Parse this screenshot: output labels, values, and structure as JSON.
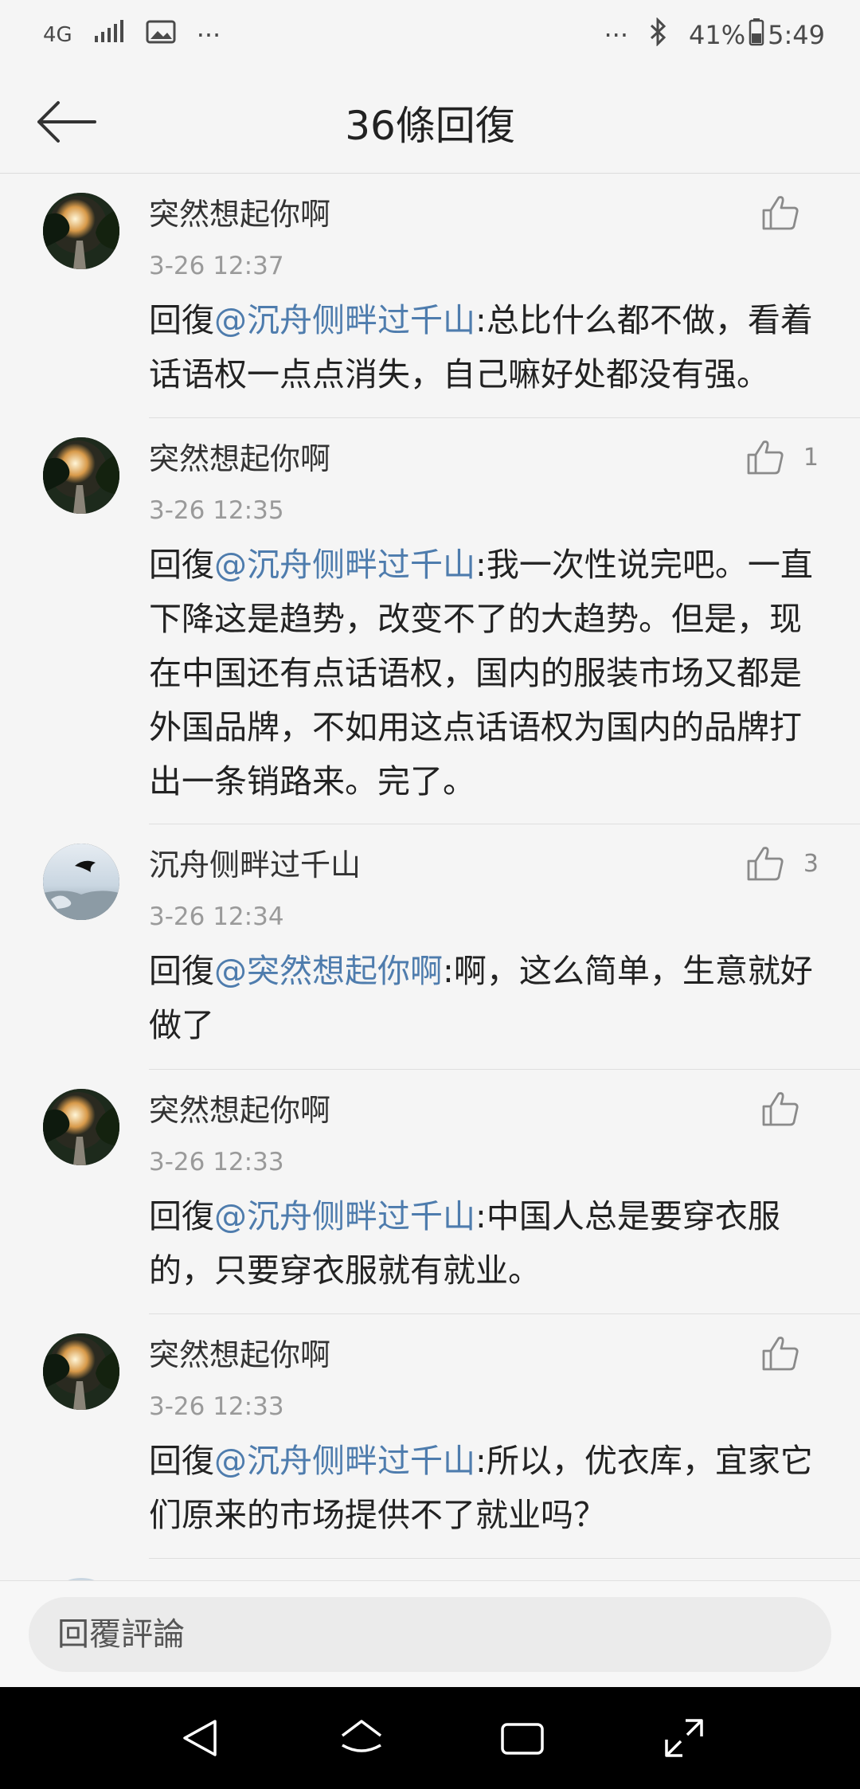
{
  "status_bar": {
    "network": "4G",
    "more_left": "···",
    "more_right": "···",
    "battery": "41%",
    "time": "5:49"
  },
  "header": {
    "title": "36條回復"
  },
  "comments": [
    {
      "author": "突然想起你啊",
      "time": "3-26 12:37",
      "reply_prefix": "回復",
      "mention": "@沉舟侧畔过千山",
      "text": ":总比什么都不做，看着话语权一点点消失，自己嘛好处都没有强。",
      "likes": ""
    },
    {
      "author": "突然想起你啊",
      "time": "3-26 12:35",
      "reply_prefix": "回復",
      "mention": "@沉舟侧畔过千山",
      "text": ":我一次性说完吧。一直下降这是趋势，改变不了的大趋势。但是，现在中国还有点话语权，国内的服装市场又都是外国品牌，不如用这点话语权为国内的品牌打出一条销路来。完了。",
      "likes": "1"
    },
    {
      "author": "沉舟侧畔过千山",
      "time": "3-26 12:34",
      "reply_prefix": "回復",
      "mention": "@突然想起你啊",
      "text": ":啊，这么简单，生意就好做了",
      "likes": "3"
    },
    {
      "author": "突然想起你啊",
      "time": "3-26 12:33",
      "reply_prefix": "回復",
      "mention": "@沉舟侧畔过千山",
      "text": ":中国人总是要穿衣服的，只要穿衣服就有就业。",
      "likes": ""
    },
    {
      "author": "突然想起你啊",
      "time": "3-26 12:33",
      "reply_prefix": "回復",
      "mention": "@沉舟侧畔过千山",
      "text": ":所以，优衣库，宜家它们原来的市场提供不了就业吗？",
      "likes": ""
    }
  ],
  "reply_bar": {
    "placeholder": "回覆評論"
  },
  "colors": {
    "mention": "#4e7cad",
    "background": "#f5f5f5",
    "time": "#9a9a9a"
  }
}
